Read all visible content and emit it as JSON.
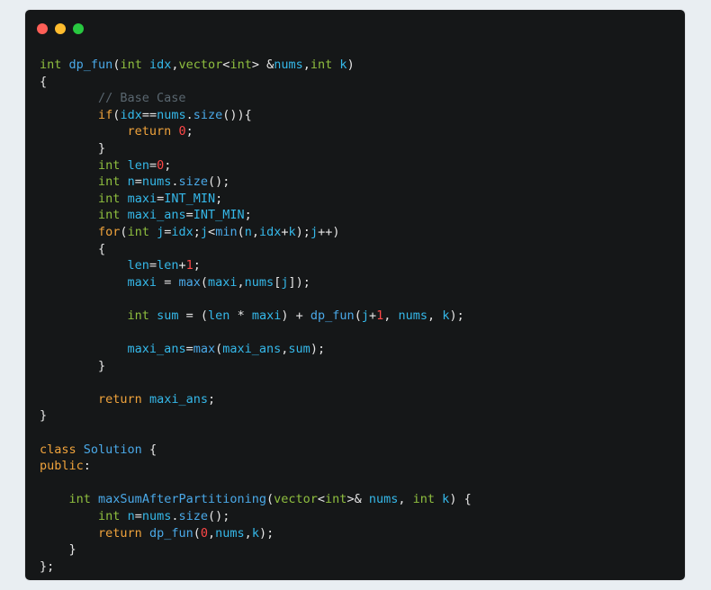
{
  "window": {
    "traffic_lights": [
      {
        "name": "close",
        "color": "#ff5f57"
      },
      {
        "name": "minimize",
        "color": "#febc2e"
      },
      {
        "name": "maximize",
        "color": "#28c840"
      }
    ]
  },
  "code": {
    "lines": [
      [
        [
          "type",
          "int"
        ],
        [
          "plain",
          " "
        ],
        [
          "func",
          "dp_fun"
        ],
        [
          "punct",
          "("
        ],
        [
          "type",
          "int"
        ],
        [
          "plain",
          " "
        ],
        [
          "ident",
          "idx"
        ],
        [
          "punct",
          ","
        ],
        [
          "type",
          "vector"
        ],
        [
          "punct",
          "<"
        ],
        [
          "type",
          "int"
        ],
        [
          "punct",
          "> "
        ],
        [
          "op",
          "&"
        ],
        [
          "ident",
          "nums"
        ],
        [
          "punct",
          ","
        ],
        [
          "type",
          "int"
        ],
        [
          "plain",
          " "
        ],
        [
          "ident",
          "k"
        ],
        [
          "punct",
          ")"
        ]
      ],
      [
        [
          "punct",
          "{"
        ]
      ],
      [
        [
          "plain",
          "        "
        ],
        [
          "comment",
          "// Base Case"
        ]
      ],
      [
        [
          "plain",
          "        "
        ],
        [
          "keyword",
          "if"
        ],
        [
          "punct",
          "("
        ],
        [
          "ident",
          "idx"
        ],
        [
          "op",
          "=="
        ],
        [
          "ident",
          "nums"
        ],
        [
          "punct",
          "."
        ],
        [
          "func",
          "size"
        ],
        [
          "punct",
          "()){"
        ]
      ],
      [
        [
          "plain",
          "            "
        ],
        [
          "keyword",
          "return"
        ],
        [
          "plain",
          " "
        ],
        [
          "number",
          "0"
        ],
        [
          "punct",
          ";"
        ]
      ],
      [
        [
          "plain",
          "        "
        ],
        [
          "punct",
          "}"
        ]
      ],
      [
        [
          "plain",
          "        "
        ],
        [
          "type",
          "int"
        ],
        [
          "plain",
          " "
        ],
        [
          "ident",
          "len"
        ],
        [
          "op",
          "="
        ],
        [
          "number",
          "0"
        ],
        [
          "punct",
          ";"
        ]
      ],
      [
        [
          "plain",
          "        "
        ],
        [
          "type",
          "int"
        ],
        [
          "plain",
          " "
        ],
        [
          "ident",
          "n"
        ],
        [
          "op",
          "="
        ],
        [
          "ident",
          "nums"
        ],
        [
          "punct",
          "."
        ],
        [
          "func",
          "size"
        ],
        [
          "punct",
          "();"
        ]
      ],
      [
        [
          "plain",
          "        "
        ],
        [
          "type",
          "int"
        ],
        [
          "plain",
          " "
        ],
        [
          "ident",
          "maxi"
        ],
        [
          "op",
          "="
        ],
        [
          "const",
          "INT_MIN"
        ],
        [
          "punct",
          ";"
        ]
      ],
      [
        [
          "plain",
          "        "
        ],
        [
          "type",
          "int"
        ],
        [
          "plain",
          " "
        ],
        [
          "ident",
          "maxi_ans"
        ],
        [
          "op",
          "="
        ],
        [
          "const",
          "INT_MIN"
        ],
        [
          "punct",
          ";"
        ]
      ],
      [
        [
          "plain",
          "        "
        ],
        [
          "keyword",
          "for"
        ],
        [
          "punct",
          "("
        ],
        [
          "type",
          "int"
        ],
        [
          "plain",
          " "
        ],
        [
          "ident",
          "j"
        ],
        [
          "op",
          "="
        ],
        [
          "ident",
          "idx"
        ],
        [
          "punct",
          ";"
        ],
        [
          "ident",
          "j"
        ],
        [
          "op",
          "<"
        ],
        [
          "func",
          "min"
        ],
        [
          "punct",
          "("
        ],
        [
          "ident",
          "n"
        ],
        [
          "punct",
          ","
        ],
        [
          "ident",
          "idx"
        ],
        [
          "op",
          "+"
        ],
        [
          "ident",
          "k"
        ],
        [
          "punct",
          ");"
        ],
        [
          "ident",
          "j"
        ],
        [
          "op",
          "++"
        ],
        [
          "punct",
          ")"
        ]
      ],
      [
        [
          "plain",
          "        "
        ],
        [
          "punct",
          "{"
        ]
      ],
      [
        [
          "plain",
          "            "
        ],
        [
          "ident",
          "len"
        ],
        [
          "op",
          "="
        ],
        [
          "ident",
          "len"
        ],
        [
          "op",
          "+"
        ],
        [
          "number",
          "1"
        ],
        [
          "punct",
          ";"
        ]
      ],
      [
        [
          "plain",
          "            "
        ],
        [
          "ident",
          "maxi"
        ],
        [
          "plain",
          " "
        ],
        [
          "op",
          "="
        ],
        [
          "plain",
          " "
        ],
        [
          "func",
          "max"
        ],
        [
          "punct",
          "("
        ],
        [
          "ident",
          "maxi"
        ],
        [
          "punct",
          ","
        ],
        [
          "ident",
          "nums"
        ],
        [
          "punct",
          "["
        ],
        [
          "ident",
          "j"
        ],
        [
          "punct",
          "]);"
        ]
      ],
      [
        [
          "plain",
          ""
        ]
      ],
      [
        [
          "plain",
          "            "
        ],
        [
          "type",
          "int"
        ],
        [
          "plain",
          " "
        ],
        [
          "ident",
          "sum"
        ],
        [
          "plain",
          " "
        ],
        [
          "op",
          "="
        ],
        [
          "plain",
          " "
        ],
        [
          "punct",
          "("
        ],
        [
          "ident",
          "len"
        ],
        [
          "plain",
          " "
        ],
        [
          "op",
          "*"
        ],
        [
          "plain",
          " "
        ],
        [
          "ident",
          "maxi"
        ],
        [
          "punct",
          ")"
        ],
        [
          "plain",
          " "
        ],
        [
          "op",
          "+"
        ],
        [
          "plain",
          " "
        ],
        [
          "func",
          "dp_fun"
        ],
        [
          "punct",
          "("
        ],
        [
          "ident",
          "j"
        ],
        [
          "op",
          "+"
        ],
        [
          "number",
          "1"
        ],
        [
          "punct",
          ", "
        ],
        [
          "ident",
          "nums"
        ],
        [
          "punct",
          ", "
        ],
        [
          "ident",
          "k"
        ],
        [
          "punct",
          ");"
        ]
      ],
      [
        [
          "plain",
          ""
        ]
      ],
      [
        [
          "plain",
          "            "
        ],
        [
          "ident",
          "maxi_ans"
        ],
        [
          "op",
          "="
        ],
        [
          "func",
          "max"
        ],
        [
          "punct",
          "("
        ],
        [
          "ident",
          "maxi_ans"
        ],
        [
          "punct",
          ","
        ],
        [
          "ident",
          "sum"
        ],
        [
          "punct",
          ");"
        ]
      ],
      [
        [
          "plain",
          "        "
        ],
        [
          "punct",
          "}"
        ]
      ],
      [
        [
          "plain",
          ""
        ]
      ],
      [
        [
          "plain",
          "        "
        ],
        [
          "keyword",
          "return"
        ],
        [
          "plain",
          " "
        ],
        [
          "ident",
          "maxi_ans"
        ],
        [
          "punct",
          ";"
        ]
      ],
      [
        [
          "punct",
          "}"
        ]
      ],
      [
        [
          "plain",
          ""
        ]
      ],
      [
        [
          "keyword",
          "class"
        ],
        [
          "plain",
          " "
        ],
        [
          "func",
          "Solution"
        ],
        [
          "plain",
          " "
        ],
        [
          "punct",
          "{"
        ]
      ],
      [
        [
          "keyword",
          "public"
        ],
        [
          "punct",
          ":"
        ]
      ],
      [
        [
          "plain",
          ""
        ]
      ],
      [
        [
          "plain",
          "    "
        ],
        [
          "type",
          "int"
        ],
        [
          "plain",
          " "
        ],
        [
          "func",
          "maxSumAfterPartitioning"
        ],
        [
          "punct",
          "("
        ],
        [
          "type",
          "vector"
        ],
        [
          "punct",
          "<"
        ],
        [
          "type",
          "int"
        ],
        [
          "punct",
          ">"
        ],
        [
          "op",
          "&"
        ],
        [
          "plain",
          " "
        ],
        [
          "ident",
          "nums"
        ],
        [
          "punct",
          ", "
        ],
        [
          "type",
          "int"
        ],
        [
          "plain",
          " "
        ],
        [
          "ident",
          "k"
        ],
        [
          "punct",
          ") {"
        ]
      ],
      [
        [
          "plain",
          "        "
        ],
        [
          "type",
          "int"
        ],
        [
          "plain",
          " "
        ],
        [
          "ident",
          "n"
        ],
        [
          "op",
          "="
        ],
        [
          "ident",
          "nums"
        ],
        [
          "punct",
          "."
        ],
        [
          "func",
          "size"
        ],
        [
          "punct",
          "();"
        ]
      ],
      [
        [
          "plain",
          "        "
        ],
        [
          "keyword",
          "return"
        ],
        [
          "plain",
          " "
        ],
        [
          "func",
          "dp_fun"
        ],
        [
          "punct",
          "("
        ],
        [
          "number",
          "0"
        ],
        [
          "punct",
          ","
        ],
        [
          "ident",
          "nums"
        ],
        [
          "punct",
          ","
        ],
        [
          "ident",
          "k"
        ],
        [
          "punct",
          ");"
        ]
      ],
      [
        [
          "plain",
          "    "
        ],
        [
          "punct",
          "}"
        ]
      ],
      [
        [
          "punct",
          "};"
        ]
      ]
    ]
  }
}
